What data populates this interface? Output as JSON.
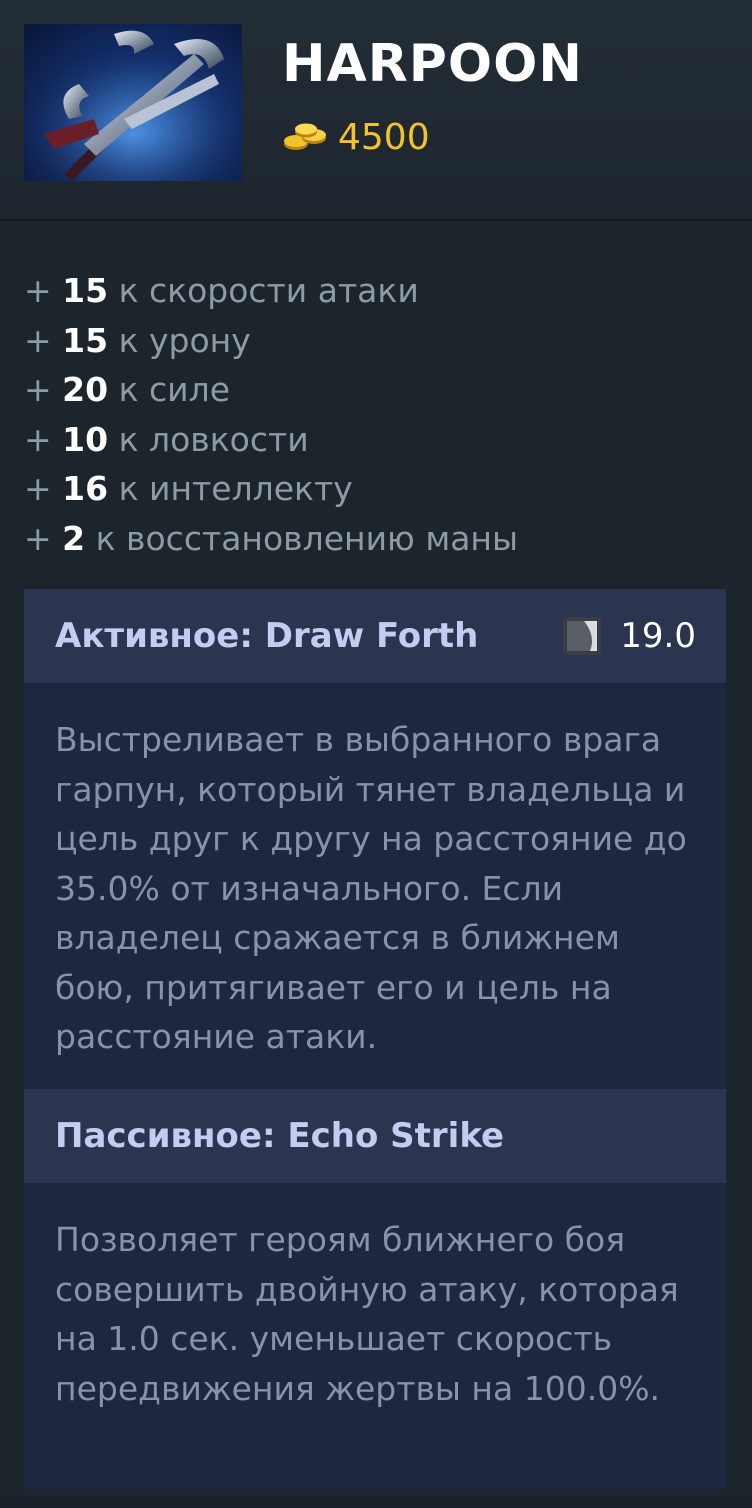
{
  "item": {
    "name": "HARPOON",
    "cost": "4500",
    "icon": "harpoon-item-icon",
    "cost_icon": "gold-coins-icon"
  },
  "stats": [
    {
      "plus": "+",
      "value": "15",
      "label": "к скорости атаки"
    },
    {
      "plus": "+",
      "value": "15",
      "label": "к урону"
    },
    {
      "plus": "+",
      "value": "20",
      "label": "к силе"
    },
    {
      "plus": "+",
      "value": "10",
      "label": "к ловкости"
    },
    {
      "plus": "+",
      "value": "16",
      "label": "к интеллекту"
    },
    {
      "plus": "+",
      "value": "2",
      "label": "к восстановлению маны"
    }
  ],
  "active_ability": {
    "title": "Активное: Draw Forth",
    "cooldown": "19.0",
    "cooldown_icon": "cooldown-icon",
    "description": "Выстреливает в выбранного врага гарпун, который тянет владельца и цель друг к другу на расстояние до 35.0% от изначального. Если владелец сражается в ближнем бою, притягивает его и цель на расстояние атаки."
  },
  "passive_ability": {
    "title": "Пассивное: Echo Strike",
    "description": "Позволяет героям ближнего боя совершить двойную атаку, которая на 1.0 сек. уменьшает скорость передвижения жертвы на 100.0%."
  },
  "colors": {
    "background": "#1c242c",
    "gold": "#f5c327",
    "ability_header": "#2b3550",
    "ability_body": "#1e2740",
    "ability_title": "#c7cbf2",
    "muted_text": "#8e9aa4"
  }
}
